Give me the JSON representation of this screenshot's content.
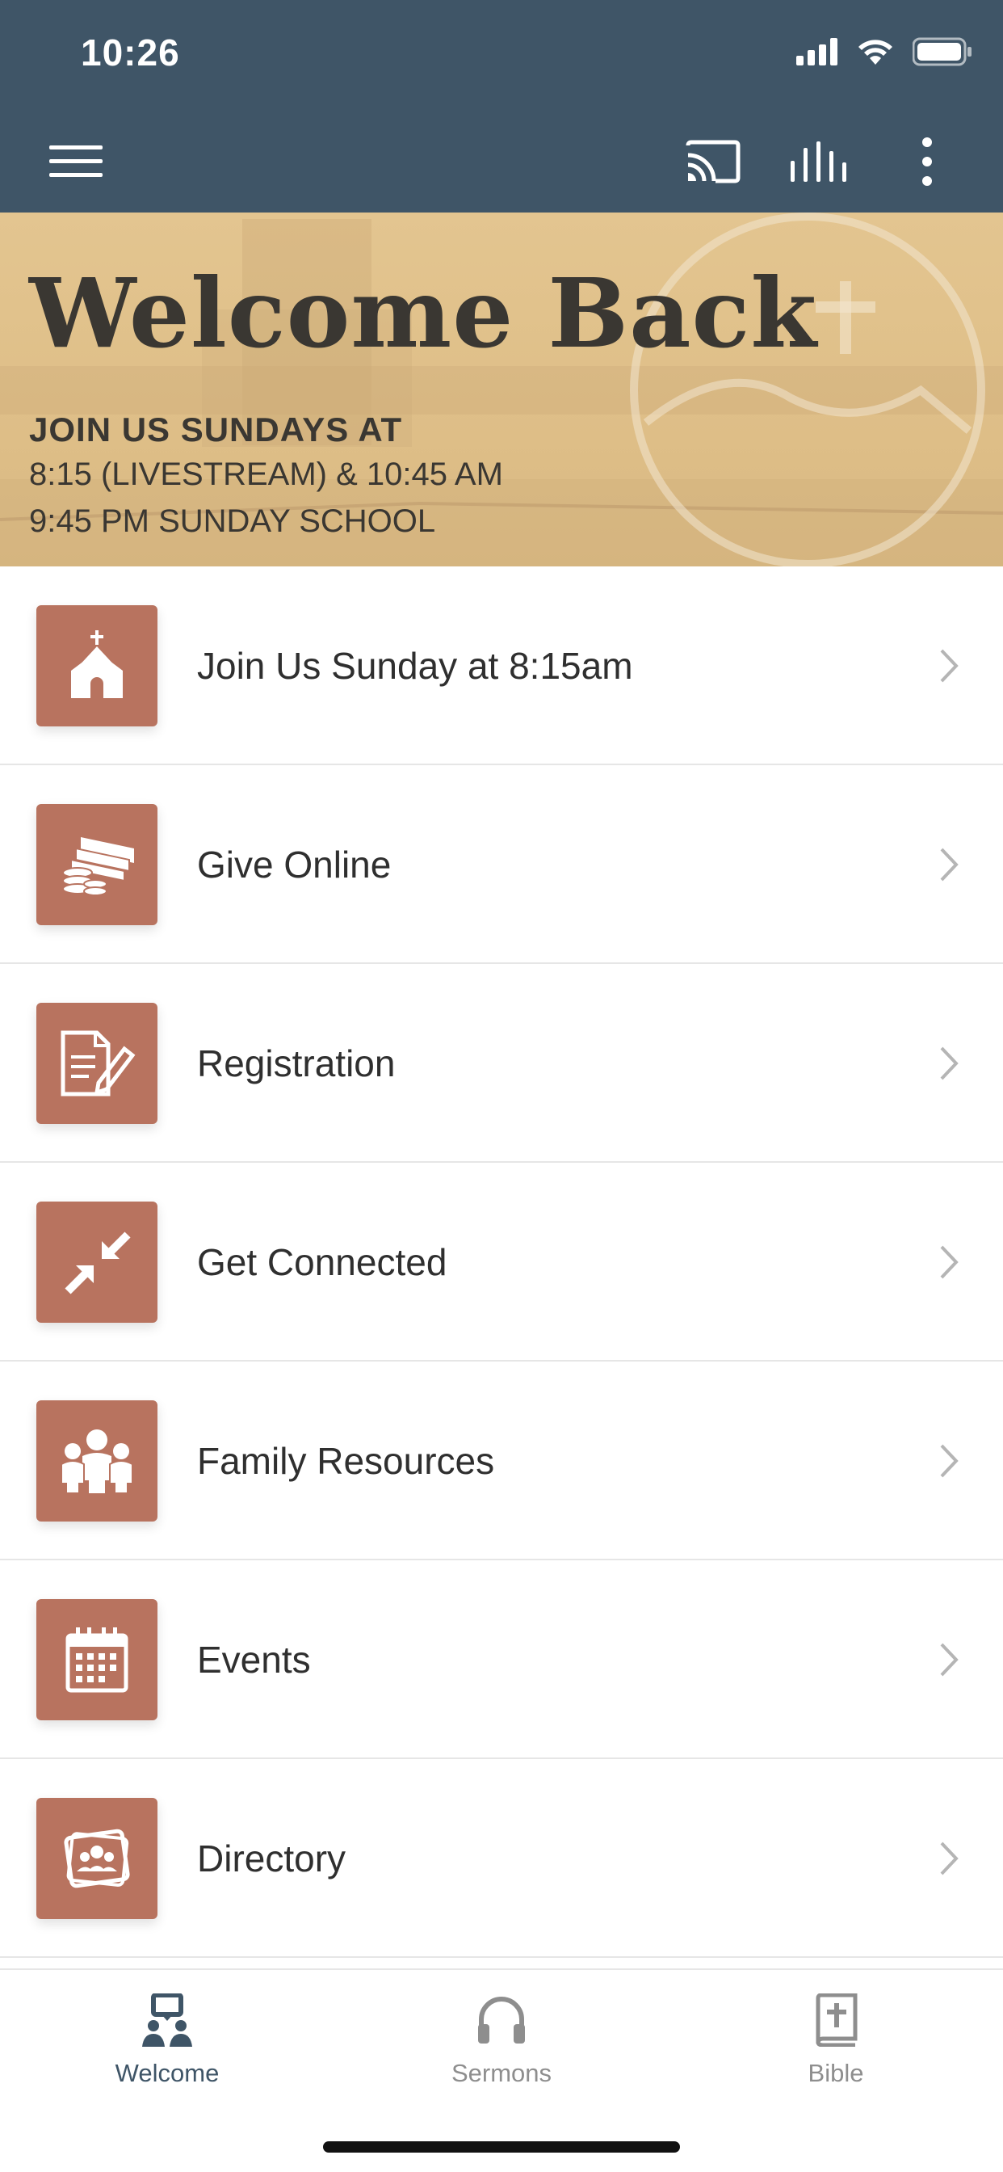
{
  "status_bar": {
    "time": "10:26"
  },
  "colors": {
    "toolbar": "#3f5567",
    "tile": "#b8735f",
    "hero": "#e3c590"
  },
  "toolbar": {
    "icons": [
      "menu-icon",
      "cast-icon",
      "audio-bars-icon",
      "more-vertical-icon"
    ]
  },
  "hero": {
    "title": "Welcome Back",
    "line1": "JOIN US SUNDAYS AT",
    "line2": "8:15 (LIVESTREAM) & 10:45 AM",
    "line3": "9:45 PM SUNDAY SCHOOL"
  },
  "menu": {
    "items": [
      {
        "label": "Join Us Sunday at 8:15am",
        "icon": "church-icon"
      },
      {
        "label": "Give Online",
        "icon": "money-icon"
      },
      {
        "label": "Registration",
        "icon": "form-edit-icon"
      },
      {
        "label": "Get Connected",
        "icon": "compress-arrows-icon"
      },
      {
        "label": "Family Resources",
        "icon": "family-icon"
      },
      {
        "label": "Events",
        "icon": "calendar-icon"
      },
      {
        "label": "Directory",
        "icon": "photo-directory-icon"
      }
    ]
  },
  "tabs": {
    "items": [
      {
        "label": "Welcome",
        "icon": "welcome-icon",
        "active": true
      },
      {
        "label": "Sermons",
        "icon": "headphones-icon",
        "active": false
      },
      {
        "label": "Bible",
        "icon": "bible-icon",
        "active": false
      }
    ]
  }
}
